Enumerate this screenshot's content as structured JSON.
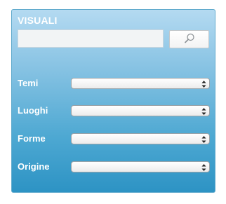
{
  "panel": {
    "title": "VISUALI"
  },
  "search": {
    "value": "",
    "placeholder": "",
    "button_icon": "search-icon"
  },
  "filters": [
    {
      "label": "Temi",
      "selected": ""
    },
    {
      "label": "Luoghi",
      "selected": ""
    },
    {
      "label": "Forme",
      "selected": ""
    },
    {
      "label": "Origine",
      "selected": ""
    }
  ],
  "colors": {
    "panel_top": "#b4daf1",
    "panel_bottom": "#2d93c4",
    "label_text": "#ffffff"
  }
}
